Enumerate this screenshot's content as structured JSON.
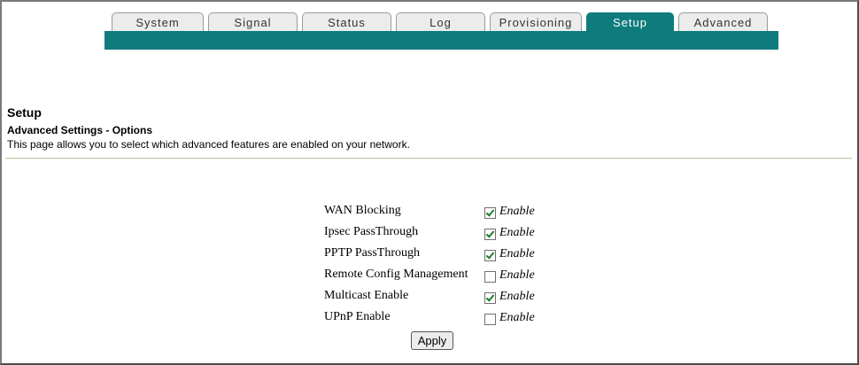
{
  "tabs": [
    {
      "label": "System"
    },
    {
      "label": "Signal"
    },
    {
      "label": "Status"
    },
    {
      "label": "Log"
    },
    {
      "label": "Provisioning"
    },
    {
      "label": "Setup",
      "active": true
    },
    {
      "label": "Advanced"
    }
  ],
  "header": {
    "title": "Setup",
    "subtitle": "Advanced Settings - Options",
    "description": "This page allows you to select which advanced features are enabled on your network."
  },
  "options": [
    {
      "label": "WAN Blocking",
      "checked": true,
      "enable_label": "Enable"
    },
    {
      "label": "Ipsec PassThrough",
      "checked": true,
      "enable_label": "Enable"
    },
    {
      "label": "PPTP PassThrough",
      "checked": true,
      "enable_label": "Enable"
    },
    {
      "label": "Remote Config Management",
      "checked": false,
      "enable_label": "Enable"
    },
    {
      "label": "Multicast Enable",
      "checked": true,
      "enable_label": "Enable"
    },
    {
      "label": "UPnP Enable",
      "checked": false,
      "enable_label": "Enable"
    }
  ],
  "apply_label": "Apply",
  "colors": {
    "accent": "#0f7b7d",
    "tab_bg": "#ececec",
    "checkmark": "#1e7a2d"
  }
}
